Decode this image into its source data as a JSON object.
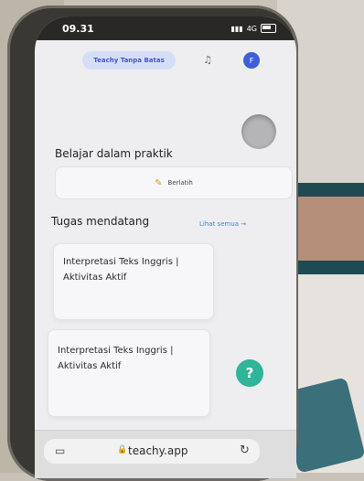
{
  "status": {
    "time": "09.31",
    "network": "4G"
  },
  "header": {
    "pill_label": "Teachy Tanpa Batas",
    "avatar_initial": "F"
  },
  "practice": {
    "section_title": "Belajar dalam praktik",
    "button_label": "Berlatih"
  },
  "tasks": {
    "title": "Tugas mendatang",
    "see_all": "Lihat semua →",
    "items": [
      {
        "title": "Interpretasi Teks Inggris | Aktivitas Aktif"
      },
      {
        "title": "Interpretasi Teks Inggris | Aktivitas Aktif"
      }
    ]
  },
  "help": {
    "label": "?"
  },
  "browser": {
    "url": "teachy.app"
  },
  "icons": [
    "bell-icon",
    "pencil-icon",
    "tabs-icon",
    "lock-icon",
    "reload-icon",
    "battery-icon"
  ],
  "colors": {
    "accent": "#3f5fd8",
    "help": "#2fb59a",
    "link": "#4a7bd8"
  }
}
